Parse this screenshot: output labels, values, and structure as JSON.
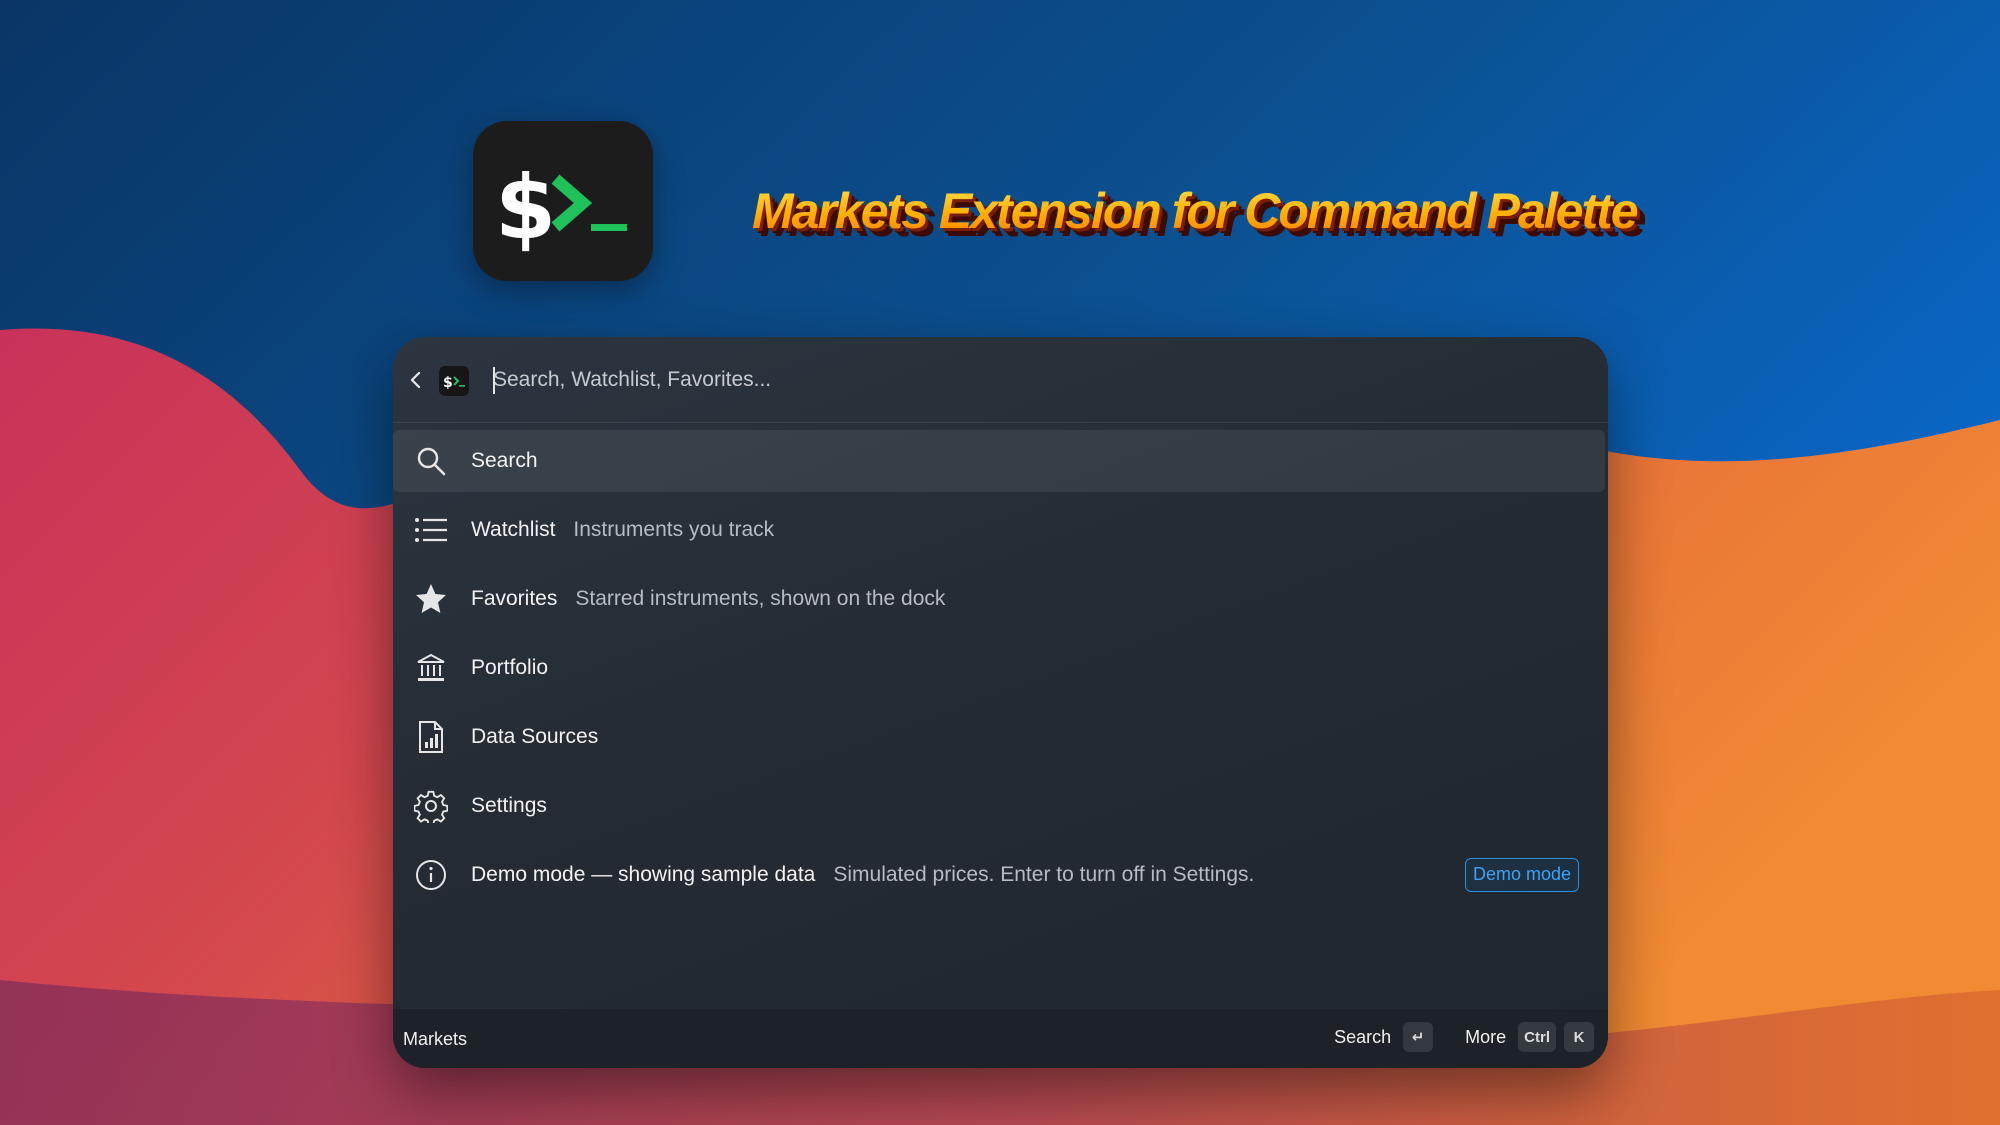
{
  "hero": {
    "title": "Markets Extension for Command Palette"
  },
  "search": {
    "placeholder": "Search, Watchlist, Favorites..."
  },
  "items": [
    {
      "label": "Search",
      "description": "",
      "icon": "search-icon",
      "selected": true
    },
    {
      "label": "Watchlist",
      "description": "Instruments you track",
      "icon": "list-icon"
    },
    {
      "label": "Favorites",
      "description": "Starred instruments, shown on the dock",
      "icon": "star-icon"
    },
    {
      "label": "Portfolio",
      "description": "",
      "icon": "bank-icon"
    },
    {
      "label": "Data Sources",
      "description": "",
      "icon": "document-chart-icon"
    },
    {
      "label": "Settings",
      "description": "",
      "icon": "gear-icon"
    },
    {
      "label": "Demo mode — showing sample data",
      "description": "Simulated prices. Enter to turn off in Settings.",
      "icon": "info-icon",
      "tag": "Demo mode"
    }
  ],
  "footer": {
    "title": "Markets",
    "primary_action": "Search",
    "primary_key": "↵",
    "secondary_action": "More",
    "secondary_keys": [
      "Ctrl",
      "K"
    ]
  },
  "colors": {
    "accent_green": "#1fc15a",
    "tag_blue": "#3da2f3",
    "title_gold": "#ffb000"
  }
}
